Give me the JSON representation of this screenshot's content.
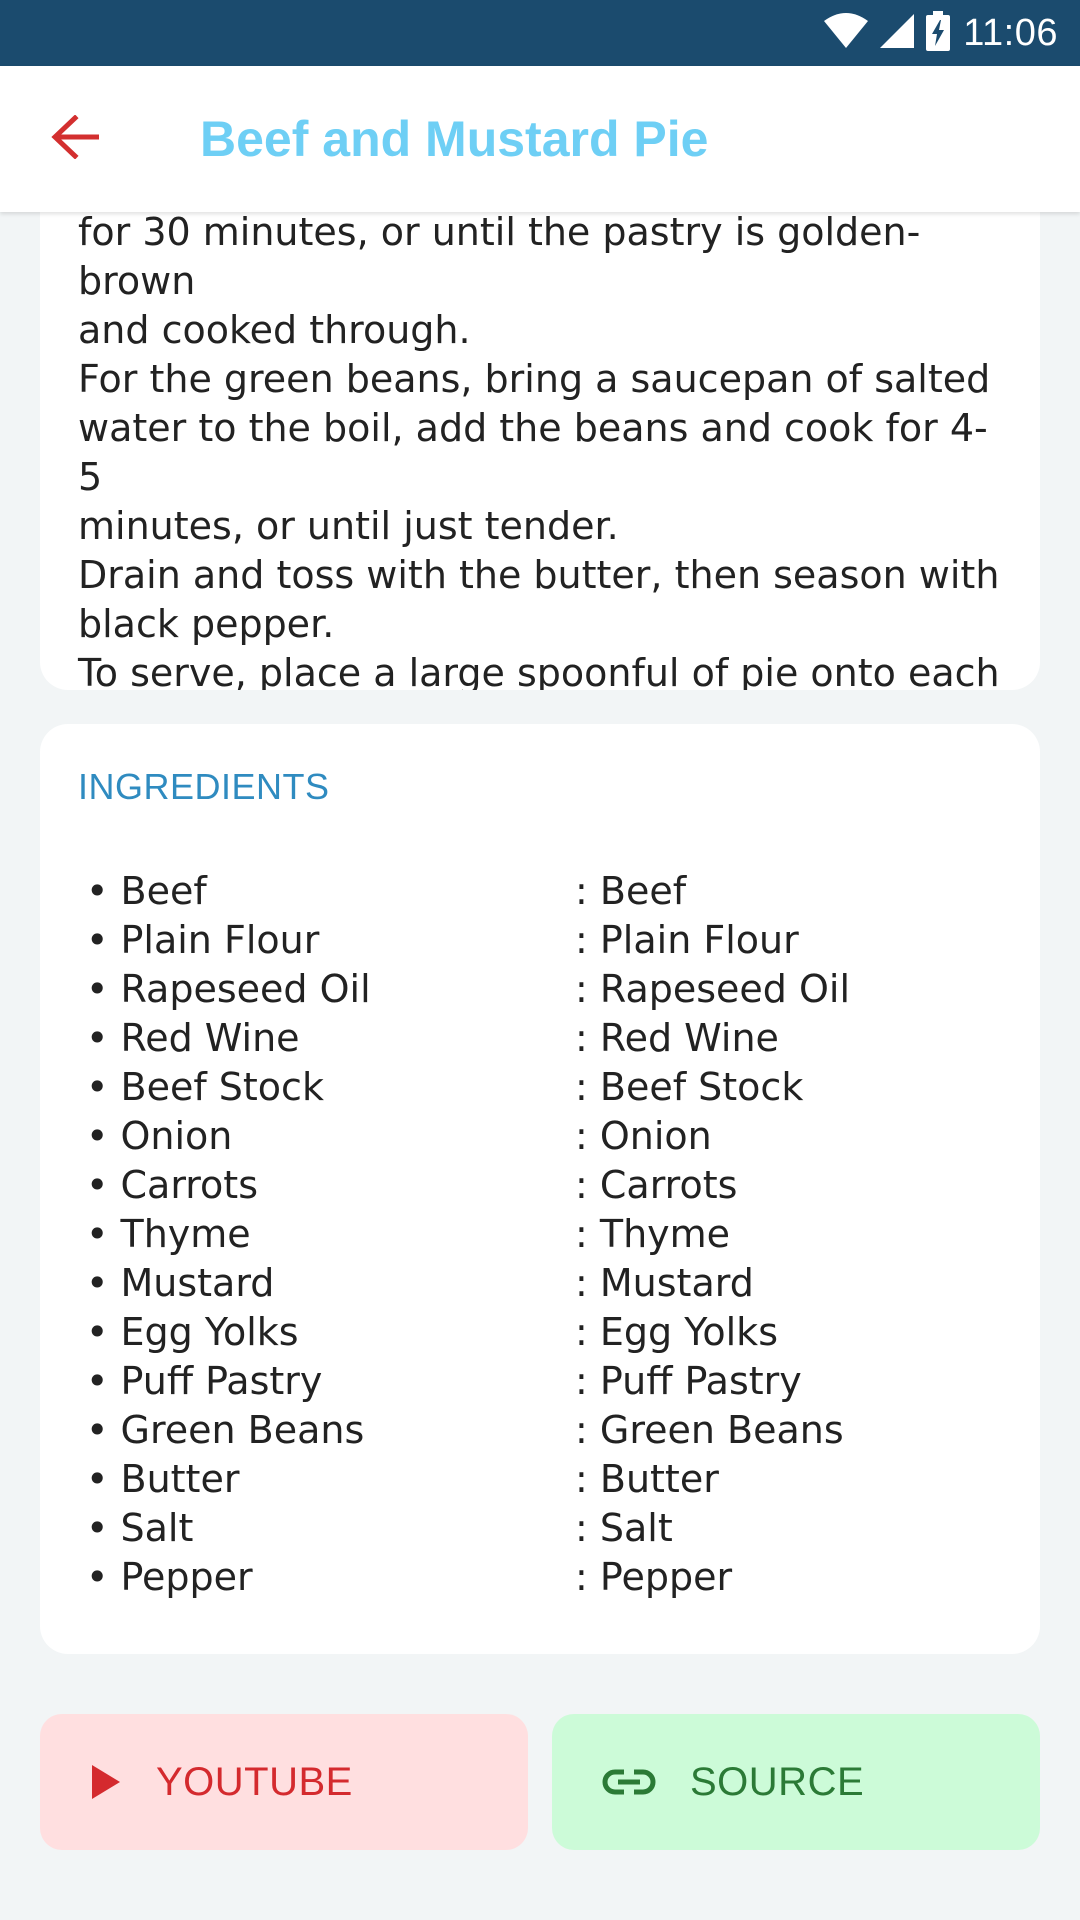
{
  "status_bar": {
    "time": "11:06",
    "icons": [
      "wifi-icon",
      "signal-icon",
      "battery-charging-icon"
    ]
  },
  "app_bar": {
    "title": "Beef and Mustard Pie",
    "back_icon": "arrow-back-icon",
    "accent_color": "#6ecff5",
    "back_color": "#d32f2f"
  },
  "instructions": {
    "text": "for 30 minutes, or until the pastry is golden-brown\nand cooked through.\nFor the green beans, bring a saucepan of salted\nwater to the boil, add the beans and cook for 4-5\nminutes, or until just tender.\nDrain and toss with the butter, then season with\nblack pepper.\nTo serve, place a large spoonful of pie onto each\nplate with some green beans alongside."
  },
  "ingredients": {
    "heading": "INGREDIENTS",
    "items": [
      {
        "name": "• Beef",
        "measure": ": Beef"
      },
      {
        "name": "• Plain Flour",
        "measure": ": Plain Flour"
      },
      {
        "name": "• Rapeseed Oil",
        "measure": ": Rapeseed Oil"
      },
      {
        "name": "• Red Wine",
        "measure": ": Red Wine"
      },
      {
        "name": "• Beef Stock",
        "measure": ": Beef Stock"
      },
      {
        "name": "• Onion",
        "measure": ": Onion"
      },
      {
        "name": "• Carrots",
        "measure": ": Carrots"
      },
      {
        "name": "• Thyme",
        "measure": ": Thyme"
      },
      {
        "name": "• Mustard",
        "measure": ": Mustard"
      },
      {
        "name": "• Egg Yolks",
        "measure": ": Egg Yolks"
      },
      {
        "name": "• Puff Pastry",
        "measure": ": Puff Pastry"
      },
      {
        "name": "• Green Beans",
        "measure": ": Green Beans"
      },
      {
        "name": "• Butter",
        "measure": ": Butter"
      },
      {
        "name": "• Salt",
        "measure": ": Salt"
      },
      {
        "name": "• Pepper",
        "measure": ": Pepper"
      }
    ]
  },
  "actions": {
    "youtube_label": "YOUTUBE",
    "youtube_icon": "play-icon",
    "source_label": "SOURCE",
    "source_icon": "link-icon"
  }
}
